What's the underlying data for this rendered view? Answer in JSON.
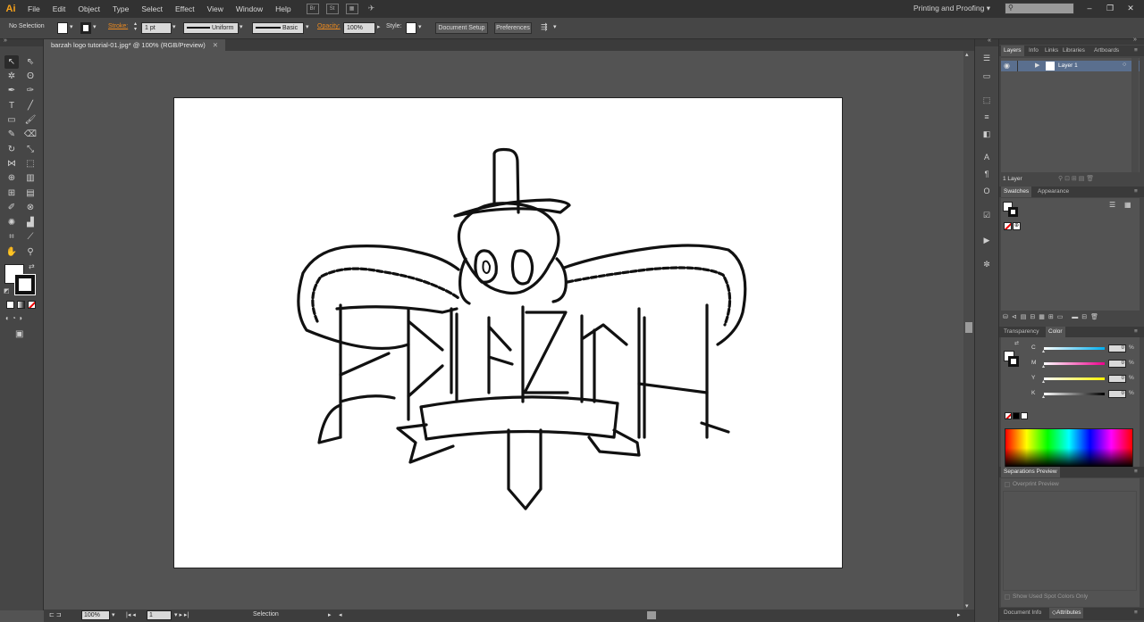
{
  "app": {
    "logo": "Ai",
    "workspace": "Printing and Proofing",
    "search_placeholder": ""
  },
  "menu": [
    "File",
    "Edit",
    "Object",
    "Type",
    "Select",
    "Effect",
    "View",
    "Window",
    "Help"
  ],
  "menubar_icons": {
    "bridge": "Br",
    "stock": "St"
  },
  "control": {
    "selection": "No Selection",
    "stroke_label": "Stroke:",
    "stroke_weight": "1 pt",
    "profile": "Uniform",
    "brush": "Basic",
    "opacity_label": "Opacity:",
    "opacity": "100%",
    "style_label": "Style:",
    "document_setup": "Document Setup",
    "preferences": "Preferences"
  },
  "document": {
    "tab_title": "barzah logo tutorial-01.jpg* @ 100% (RGB/Preview)"
  },
  "status": {
    "zoom": "100%",
    "artboard": "1",
    "tool": "Selection"
  },
  "layers_panel": {
    "tabs": [
      "Layers",
      "Info",
      "Links",
      "Libraries",
      "Artboards"
    ],
    "layer_name": "Layer 1",
    "layer_count": "1 Layer"
  },
  "swatches_panel": {
    "tabs": [
      "Swatches",
      "Appearance"
    ]
  },
  "color_panel": {
    "tabs": [
      "Transparency",
      "Color"
    ],
    "channels": [
      {
        "label": "C",
        "value": "0",
        "color": "#00aeef"
      },
      {
        "label": "M",
        "value": "0",
        "color": "#ec008c"
      },
      {
        "label": "Y",
        "value": "0",
        "color": "#fff200"
      },
      {
        "label": "K",
        "value": "0",
        "color": "#000000"
      }
    ],
    "pct": "%"
  },
  "separations_panel": {
    "title": "Separations Preview",
    "overprint": "Overprint Preview",
    "spot_only": "Show Used Spot Colors Only"
  },
  "bottom_tabs": [
    "Document Info",
    "Attributes"
  ],
  "colors": {
    "accent": "#f7a21b",
    "orange_label": "#ec8a1f",
    "layer_select": "#5a6f8e"
  }
}
